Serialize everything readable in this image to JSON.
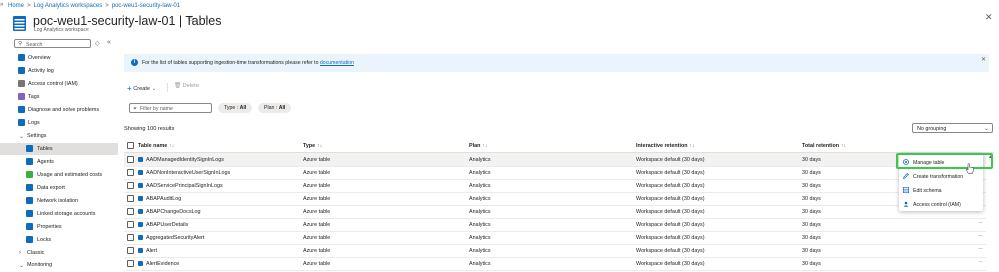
{
  "breadcrumb": [
    "Home",
    "Log Analytics workspaces",
    "poc-weu1-security-law-01"
  ],
  "header": {
    "title": "poc-weu1-security-law-01 | Tables",
    "subtitle": "Log Analytics workspace"
  },
  "sidebar": {
    "search_placeholder": "Search",
    "items": [
      {
        "label": "Overview",
        "icon": "overview-icon",
        "color": "#0f6cbd"
      },
      {
        "label": "Activity log",
        "icon": "activity-log-icon",
        "color": "#0f6cbd"
      },
      {
        "label": "Access control (IAM)",
        "icon": "iam-icon",
        "color": "#7a7574"
      },
      {
        "label": "Tags",
        "icon": "tag-icon",
        "color": "#8661c5"
      },
      {
        "label": "Diagnose and solve problems",
        "icon": "wrench-icon",
        "color": "#0f6cbd"
      },
      {
        "label": "Logs",
        "icon": "logs-icon",
        "color": "#0f6cbd"
      },
      {
        "label": "Settings",
        "icon": "chevron-down-icon",
        "color": "#605e5c"
      },
      {
        "label": "Tables",
        "icon": "table-icon",
        "color": "#0f6cbd"
      },
      {
        "label": "Agents",
        "icon": "agents-icon",
        "color": "#0f6cbd"
      },
      {
        "label": "Usage and estimated costs",
        "icon": "usage-icon",
        "color": "#3cb043"
      },
      {
        "label": "Data export",
        "icon": "data-export-icon",
        "color": "#0f6cbd"
      },
      {
        "label": "Network isolation",
        "icon": "network-icon",
        "color": "#0f6cbd"
      },
      {
        "label": "Linked storage accounts",
        "icon": "storage-icon",
        "color": "#0f6cbd"
      },
      {
        "label": "Properties",
        "icon": "properties-icon",
        "color": "#0f6cbd"
      },
      {
        "label": "Locks",
        "icon": "lock-icon",
        "color": "#0f6cbd"
      },
      {
        "label": "Classic",
        "icon": "chevron-right-icon",
        "color": "#605e5c"
      },
      {
        "label": "Monitoring",
        "icon": "chevron-down-icon",
        "color": "#605e5c"
      }
    ]
  },
  "info_bar": {
    "text": "For the list of tables supporting ingestion-time transformations please refer to",
    "link": "documentation"
  },
  "toolbar": {
    "create": "Create",
    "delete": "Delete"
  },
  "filters": {
    "placeholder": "Filter by name",
    "type_label": "Type : ",
    "type_value": "All",
    "plan_label": "Plan : ",
    "plan_value": "All"
  },
  "showing": "Showing 100 results",
  "grouping": "No grouping",
  "columns": [
    "Table name",
    "Type",
    "Plan",
    "Interactive retention",
    "Total retention"
  ],
  "rows": [
    [
      "AADManagedIdentitySignInLogs",
      "Azure table",
      "Analytics",
      "Workspace default (30 days)",
      "30 days"
    ],
    [
      "AADNonInteractiveUserSignInLogs",
      "Azure table",
      "Analytics",
      "Workspace default (30 days)",
      "30 days"
    ],
    [
      "AADServicePrincipalSignInLogs",
      "Azure table",
      "Analytics",
      "Workspace default (30 days)",
      "30 days"
    ],
    [
      "ABAPAuditLog",
      "Azure table",
      "Analytics",
      "Workspace default (30 days)",
      "30 days"
    ],
    [
      "ABAPChangeDocsLog",
      "Azure table",
      "Analytics",
      "Workspace default (30 days)",
      "30 days"
    ],
    [
      "ABAPUserDetails",
      "Azure table",
      "Analytics",
      "Workspace default (30 days)",
      "30 days"
    ],
    [
      "AggregatedSecurityAlert",
      "Azure table",
      "Analytics",
      "Workspace default (30 days)",
      "30 days"
    ],
    [
      "Alert",
      "Azure table",
      "Analytics",
      "Workspace default (30 days)",
      "30 days"
    ],
    [
      "AlertEvidence",
      "Azure table",
      "Analytics",
      "Workspace default (30 days)",
      "30 days"
    ]
  ],
  "context_menu": [
    {
      "label": "Manage table",
      "icon": "gear-icon"
    },
    {
      "label": "Create transformation",
      "icon": "pencil-icon"
    },
    {
      "label": "Edit schema",
      "icon": "table-icon"
    },
    {
      "label": "Access control (IAM)",
      "icon": "iam-icon"
    }
  ],
  "colors": {
    "accent": "#0f6cbd",
    "highlight": "#3cc74e"
  }
}
